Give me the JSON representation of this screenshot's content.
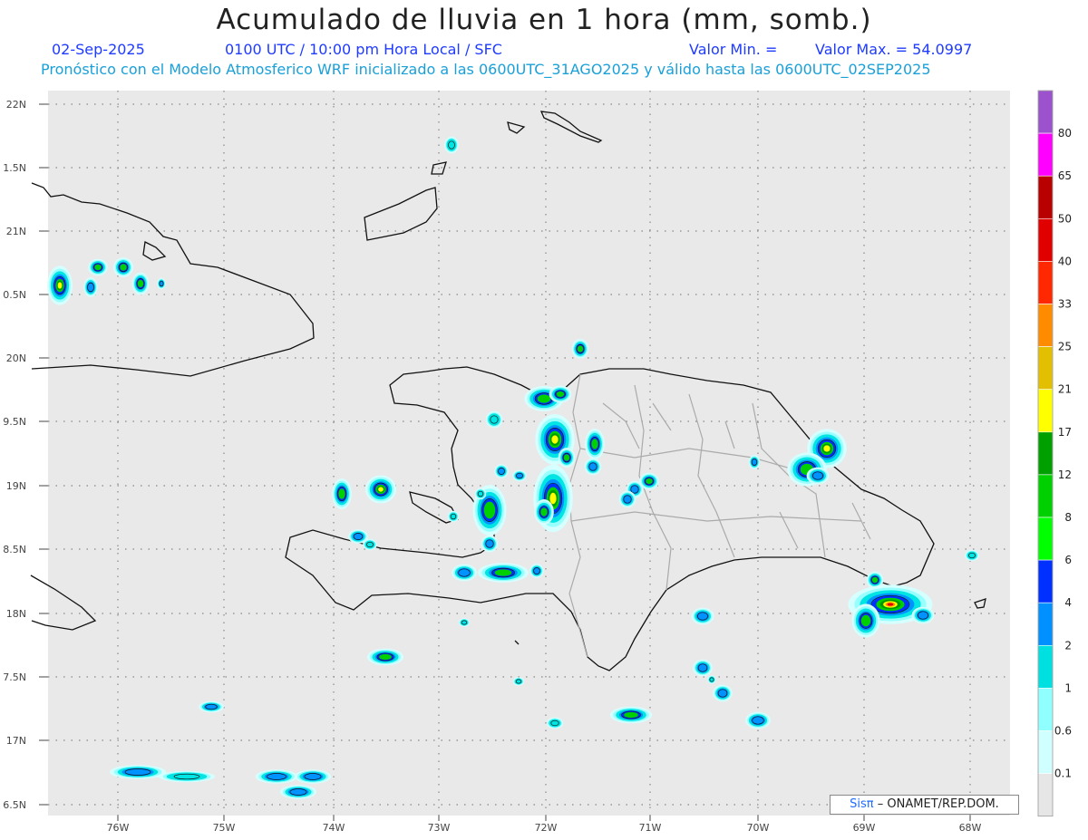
{
  "header": {
    "title": "Acumulado de lluvia en 1 hora (mm, somb.)",
    "date": "02-Sep-2025",
    "time": "0100 UTC / 10:00 pm Hora Local / SFC",
    "min_label": "Valor Min. =",
    "max_label": "Valor Max. = 54.0997",
    "description": "Pronóstico con el Modelo Atmosferico WRF inicializado a las 0600UTC_31AGO2025 y válido hasta las  0600UTC_02SEP2025"
  },
  "axes": {
    "lon_labels": [
      "76W",
      "75W",
      "74W",
      "73W",
      "72W",
      "71W",
      "70W",
      "69W",
      "68W"
    ],
    "lat_labels": [
      "22N",
      "1.5N",
      "21N",
      "0.5N",
      "20N",
      "9.5N",
      "19N",
      "8.5N",
      "18N",
      "7.5N",
      "17N",
      "6.5N"
    ]
  },
  "colorbar": {
    "labels": [
      "80",
      "65",
      "50",
      "40",
      "33",
      "25",
      "21",
      "17",
      "12",
      "8",
      "6",
      "4",
      "2",
      "1",
      "0.6",
      "0.1"
    ],
    "colors": [
      "#9b52cc",
      "#ff00ff",
      "#b80000",
      "#e00000",
      "#ff2800",
      "#ff8c00",
      "#e2bf00",
      "#ffff00",
      "#00a000",
      "#00d000",
      "#00ff00",
      "#0030ff",
      "#0090ff",
      "#00e0e0",
      "#90ffff",
      "#d0ffff",
      "#e6e6e6"
    ]
  },
  "credit": {
    "brand": "Sisπ",
    "org": "– ONAMET/REP.DOM."
  }
}
